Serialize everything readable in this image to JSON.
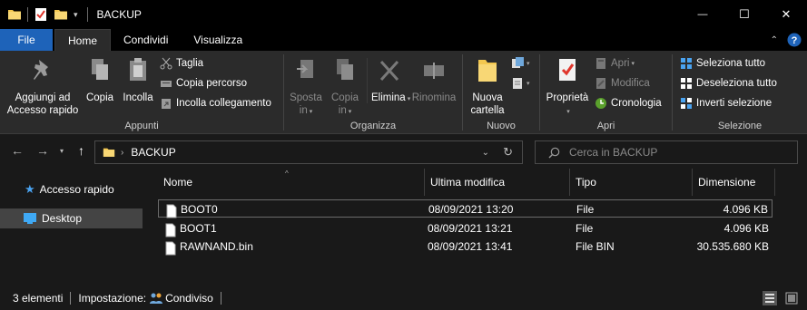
{
  "window": {
    "title": "BACKUP",
    "controls": {
      "minimize": "—",
      "maximize": "☐",
      "close": "✕"
    }
  },
  "ribbon_tabs": {
    "file": "File",
    "items": [
      "Home",
      "Condividi",
      "Visualizza"
    ],
    "active": "Home"
  },
  "ribbon": {
    "appunti": {
      "label": "Appunti",
      "pin": [
        "Aggiungi ad",
        "Accesso rapido"
      ],
      "copy": "Copia",
      "paste": "Incolla",
      "cut": "Taglia",
      "copy_path": "Copia percorso",
      "paste_shortcut": "Incolla collegamento"
    },
    "organizza": {
      "label": "Organizza",
      "move": [
        "Sposta",
        "in"
      ],
      "copyto": [
        "Copia",
        "in"
      ],
      "delete": "Elimina",
      "rename": "Rinomina"
    },
    "nuovo": {
      "label": "Nuovo",
      "new_folder": [
        "Nuova",
        "cartella"
      ]
    },
    "apri": {
      "label": "Apri",
      "properties": "Proprietà",
      "open": "Apri",
      "edit": "Modifica",
      "history": "Cronologia"
    },
    "selezione": {
      "label": "Selezione",
      "select_all": "Seleziona tutto",
      "select_none": "Deseleziona tutto",
      "invert": "Inverti selezione"
    }
  },
  "address": {
    "path": "BACKUP",
    "search_placeholder": "Cerca in BACKUP"
  },
  "nav_pane": {
    "items": [
      {
        "label": "Accesso rapido",
        "icon": "star-icon"
      },
      {
        "label": "Desktop",
        "icon": "desktop-icon"
      }
    ]
  },
  "files": {
    "columns": [
      "Nome",
      "Ultima modifica",
      "Tipo",
      "Dimensione"
    ],
    "rows": [
      {
        "name": "BOOT0",
        "modified": "08/09/2021 13:20",
        "type": "File",
        "size": "4.096 KB"
      },
      {
        "name": "BOOT1",
        "modified": "08/09/2021 13:21",
        "type": "File",
        "size": "4.096 KB"
      },
      {
        "name": "RAWNAND.bin",
        "modified": "08/09/2021 13:41",
        "type": "File BIN",
        "size": "30.535.680 KB"
      }
    ]
  },
  "status": {
    "count": "3 elementi",
    "sharing_label": "Impostazione:",
    "sharing_value": "Condiviso"
  },
  "colors": {
    "accent": "#1e63b9",
    "background": "#191919",
    "ribbon": "#2b2b2b",
    "folder": "#f3c74f"
  }
}
